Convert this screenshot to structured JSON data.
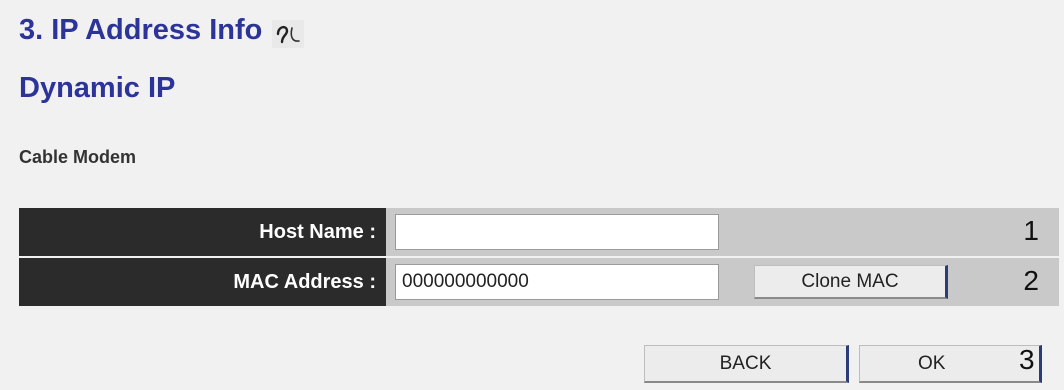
{
  "header": {
    "title": "3. IP Address Info",
    "subtitle": "Dynamic IP",
    "help_icon": "help-icon"
  },
  "section_label": "Cable Modem",
  "form": {
    "host_name": {
      "label": "Host Name :",
      "value": "",
      "row_number": "1"
    },
    "mac_address": {
      "label": "MAC Address :",
      "value": "000000000000",
      "row_number": "2",
      "clone_button": "Clone MAC"
    }
  },
  "actions": {
    "back_label": "BACK",
    "ok_label": "OK",
    "step_number": "3"
  },
  "colors": {
    "title": "#2c3399",
    "label_bg": "#2b2b2b",
    "value_bg": "#c9c9c9",
    "page_bg": "#f1f1f1"
  }
}
